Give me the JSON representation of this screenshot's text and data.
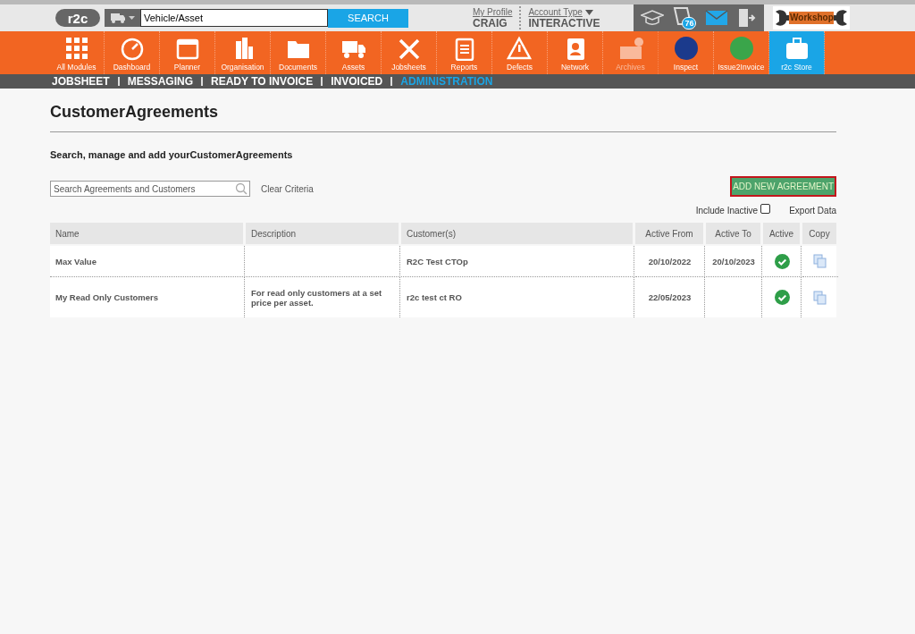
{
  "header": {
    "logo": "r2c",
    "search": {
      "value": "Vehicle/Asset",
      "button": "SEARCH"
    },
    "profile_link": "My Profile",
    "user": "CRAIG",
    "account_type_link": "Account Type",
    "account_type": "INTERACTIVE",
    "notification_count": "76",
    "workshop": "Workshop"
  },
  "modules": [
    {
      "label": "All Modules",
      "selected": false,
      "disabled": false
    },
    {
      "label": "Dashboard",
      "selected": false,
      "disabled": false
    },
    {
      "label": "Planner",
      "selected": false,
      "disabled": false
    },
    {
      "label": "Organisation",
      "selected": false,
      "disabled": false
    },
    {
      "label": "Documents",
      "selected": false,
      "disabled": false
    },
    {
      "label": "Assets",
      "selected": false,
      "disabled": false
    },
    {
      "label": "Jobsheets",
      "selected": false,
      "disabled": false
    },
    {
      "label": "Reports",
      "selected": false,
      "disabled": false
    },
    {
      "label": "Defects",
      "selected": false,
      "disabled": false
    },
    {
      "label": "Network",
      "selected": false,
      "disabled": false
    },
    {
      "label": "Archives",
      "selected": false,
      "disabled": true
    },
    {
      "label": "Inspect",
      "selected": false,
      "disabled": false
    },
    {
      "label": "Issue2Invoice",
      "selected": false,
      "disabled": false
    },
    {
      "label": "r2c Store",
      "selected": true,
      "disabled": false
    }
  ],
  "subnav": [
    {
      "label": "JOBSHEET",
      "selected": false
    },
    {
      "label": "MESSAGING",
      "selected": false
    },
    {
      "label": "READY TO INVOICE",
      "selected": false
    },
    {
      "label": "INVOICED",
      "selected": false
    },
    {
      "label": "ADMINISTRATION",
      "selected": true
    }
  ],
  "page": {
    "title": "CustomerAgreements",
    "subtitle": "Search, manage and add yourCustomerAgreements",
    "search_placeholder": "Search Agreements and Customers",
    "clear": "Clear Criteria",
    "add_button": "ADD NEW AGREEMENT",
    "include_inactive": {
      "label": "Include Inactive",
      "checked": false
    },
    "export": "Export Data"
  },
  "table": {
    "columns": [
      "Name",
      "Description",
      "Customer(s)",
      "Active From",
      "Active To",
      "Active",
      "Copy"
    ],
    "rows": [
      {
        "name": "Max Value",
        "description": "",
        "customers": "R2C Test CTOp",
        "active_from": "20/10/2022",
        "active_to": "20/10/2023",
        "active": true
      },
      {
        "name": "My Read Only Customers",
        "description": "For read only customers at a set price per asset.",
        "customers": "r2c test ct RO",
        "active_from": "22/05/2023",
        "active_to": "",
        "active": true
      }
    ]
  }
}
